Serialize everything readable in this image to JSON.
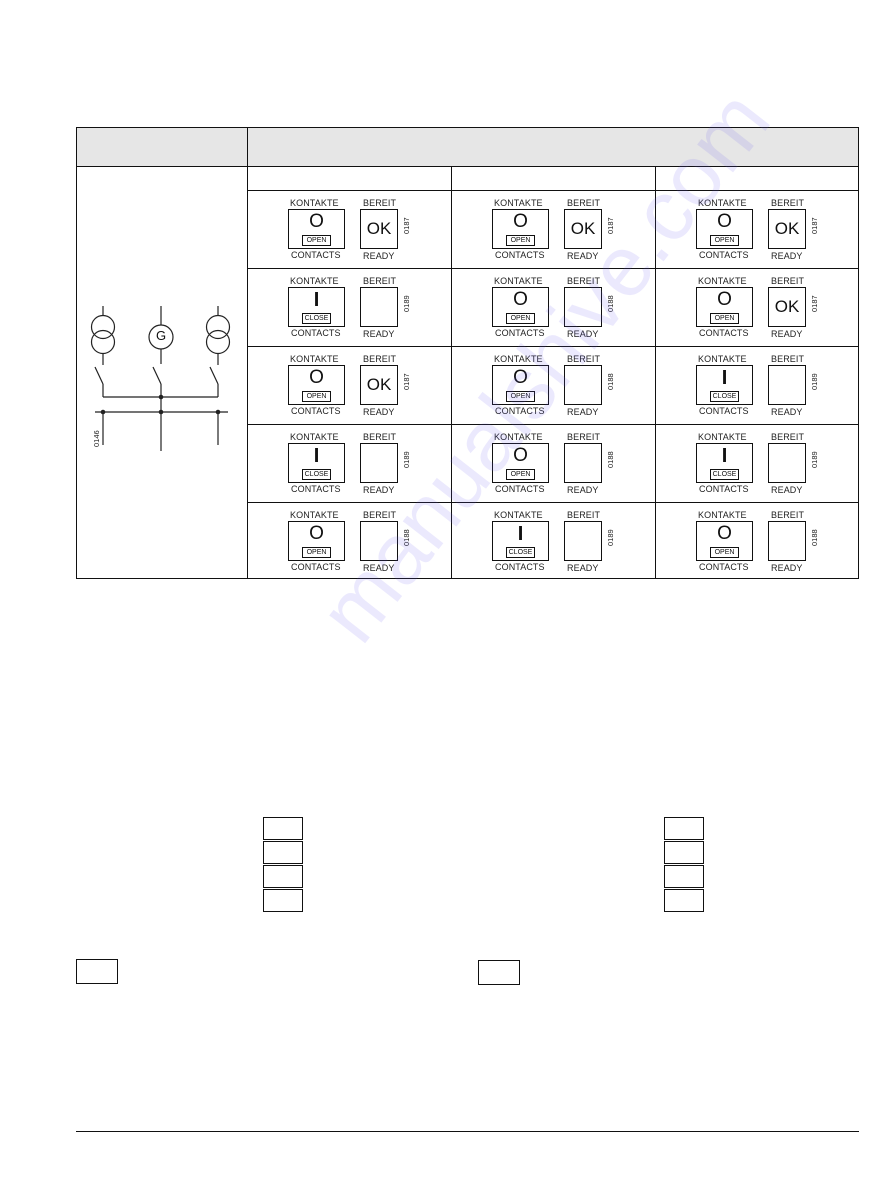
{
  "watermark": "manualshive.com",
  "diagram": {
    "generator_label": "G",
    "figure_code": "0146"
  },
  "labels": {
    "kontakte": "KONTAKTE",
    "contacts": "CONTACTS",
    "bereit": "BEREIT",
    "ready": "READY"
  },
  "states": {
    "open": {
      "symbol": "O",
      "tag": "OPEN"
    },
    "closed": {
      "symbol": "I",
      "tag": "CLOSE"
    },
    "ok_text": "OK"
  },
  "grid": [
    [
      {
        "contact": "open",
        "ready": true,
        "code": "0187"
      },
      {
        "contact": "open",
        "ready": true,
        "code": "0187"
      },
      {
        "contact": "open",
        "ready": true,
        "code": "0187"
      }
    ],
    [
      {
        "contact": "closed",
        "ready": false,
        "code": "0189"
      },
      {
        "contact": "open",
        "ready": false,
        "code": "0188"
      },
      {
        "contact": "open",
        "ready": true,
        "code": "0187"
      }
    ],
    [
      {
        "contact": "open",
        "ready": true,
        "code": "0187"
      },
      {
        "contact": "open",
        "ready": false,
        "code": "0188"
      },
      {
        "contact": "closed",
        "ready": false,
        "code": "0189"
      }
    ],
    [
      {
        "contact": "closed",
        "ready": false,
        "code": "0189"
      },
      {
        "contact": "open",
        "ready": false,
        "code": "0188"
      },
      {
        "contact": "closed",
        "ready": false,
        "code": "0189"
      }
    ],
    [
      {
        "contact": "open",
        "ready": false,
        "code": "0188"
      },
      {
        "contact": "closed",
        "ready": false,
        "code": "0189"
      },
      {
        "contact": "open",
        "ready": false,
        "code": "0188"
      }
    ]
  ]
}
